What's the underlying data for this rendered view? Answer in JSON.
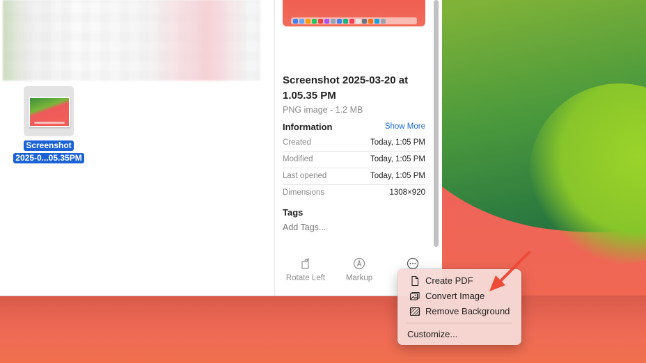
{
  "file": {
    "icon_label_line1": "Screenshot",
    "icon_label_line2": "2025-0...05.35PM"
  },
  "inspector": {
    "title": "Screenshot 2025-03-20 at 1.05.35 PM",
    "subtitle": "PNG image - 1.2 MB",
    "information_heading": "Information",
    "show_more": "Show More",
    "rows": [
      {
        "key": "Created",
        "value": "Today, 1:05 PM"
      },
      {
        "key": "Modified",
        "value": "Today, 1:05 PM"
      },
      {
        "key": "Last opened",
        "value": "Today, 1:05 PM"
      },
      {
        "key": "Dimensions",
        "value": "1308×920"
      }
    ],
    "tags_heading": "Tags",
    "tags_placeholder": "Add Tags..."
  },
  "actions": {
    "rotate_left": "Rotate Left",
    "markup": "Markup",
    "more_icon": "ellipsis-circle-icon"
  },
  "menu": {
    "items": [
      {
        "label": "Create PDF",
        "icon": "document-icon"
      },
      {
        "label": "Convert Image",
        "icon": "photo-stack-icon"
      },
      {
        "label": "Remove Background",
        "icon": "remove-background-icon"
      },
      {
        "label": "Customize..."
      }
    ]
  },
  "colors": {
    "selection": "#1a62d6",
    "link": "#1a6ad6",
    "annotation_arrow": "#ee4a38"
  }
}
